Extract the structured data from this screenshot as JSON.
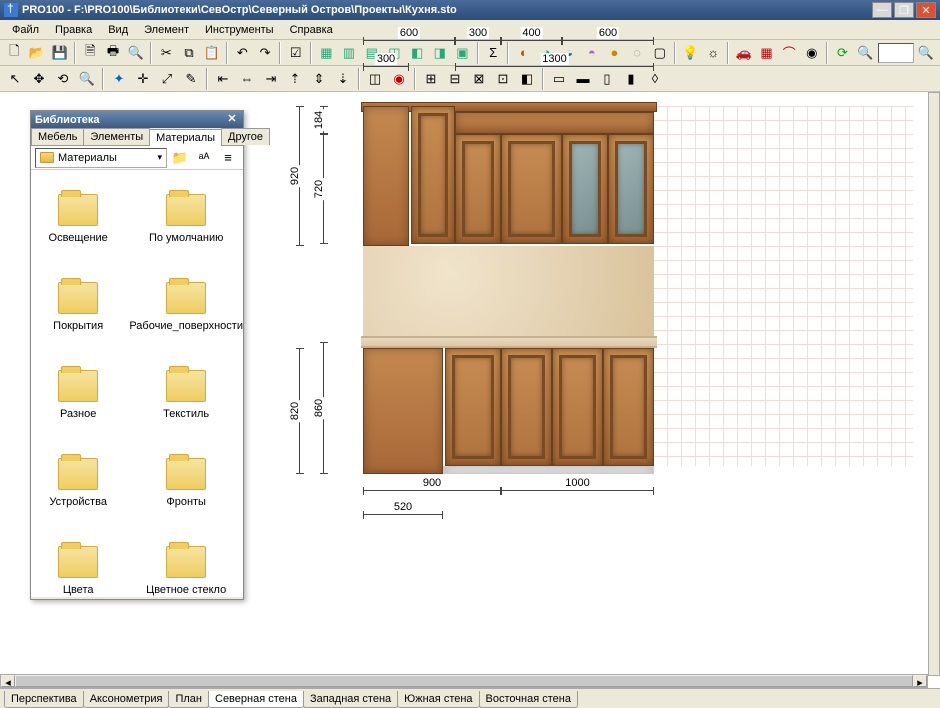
{
  "title": "PRO100 - F:\\PRO100\\Библиотеки\\СевОстр\\Северный Остров\\Проекты\\Кухня.sto",
  "menu": [
    "Файл",
    "Правка",
    "Вид",
    "Элемент",
    "Инструменты",
    "Справка"
  ],
  "library": {
    "title": "Библиотека",
    "tabs": [
      "Мебель",
      "Элементы",
      "Материалы",
      "Другое"
    ],
    "active_tab": 2,
    "combo": "Материалы",
    "items": [
      "Освещение",
      "По умолчанию",
      "Покрытия",
      "Рабочие_поверхности",
      "Разное",
      "Текстиль",
      "Устройства",
      "Фронты",
      "Цвета",
      "Цветное стекло"
    ]
  },
  "dims_top1": [
    "600",
    "300",
    "400",
    "600"
  ],
  "dims_top2": [
    "300",
    "1300"
  ],
  "dims_left": {
    "a": "184",
    "b": "720",
    "outer": "920"
  },
  "dims_left2": {
    "a": "860",
    "outer": "820"
  },
  "dims_bottom": [
    "900",
    "1000"
  ],
  "dims_bottom2": "520",
  "bottom_tabs": [
    "Перспектива",
    "Аксонометрия",
    "План",
    "Северная стена",
    "Западная стена",
    "Южная стена",
    "Восточная стена"
  ],
  "active_bottom": 3,
  "zoom": ""
}
